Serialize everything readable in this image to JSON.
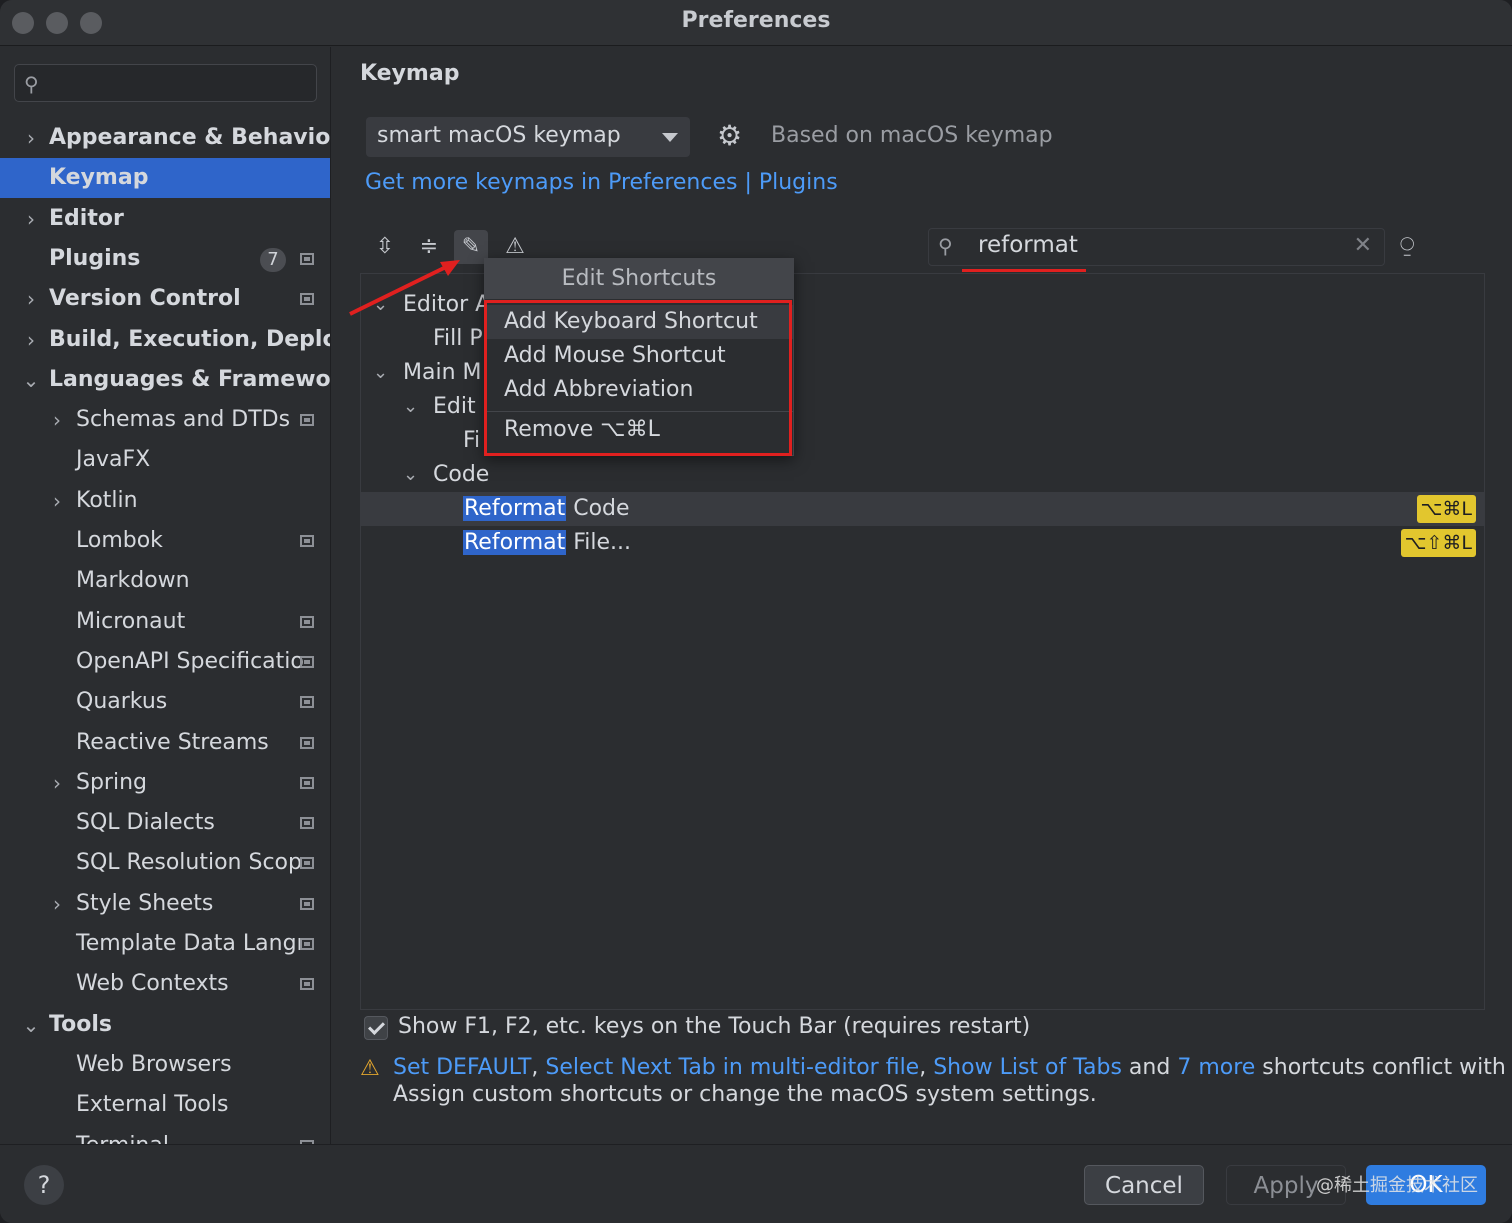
{
  "window": {
    "title": "Preferences"
  },
  "sidebar": {
    "search_placeholder": "",
    "items": [
      {
        "label": "Appearance & Behavior",
        "chevron": "›",
        "bold": true
      },
      {
        "label": "Keymap",
        "chevron": "",
        "bold": true,
        "selected": true
      },
      {
        "label": "Editor",
        "chevron": "›",
        "bold": true
      },
      {
        "label": "Plugins",
        "chevron": "",
        "bold": true,
        "badge": "7",
        "icon": "project-icon"
      },
      {
        "label": "Version Control",
        "chevron": "›",
        "bold": true,
        "icon": "project-icon"
      },
      {
        "label": "Build, Execution, Deploy",
        "chevron": "›",
        "bold": true
      },
      {
        "label": "Languages & Framewor",
        "chevron": "⌄",
        "bold": true
      },
      {
        "label": "Schemas and DTDs",
        "chevron": "›",
        "icon": "project-icon"
      },
      {
        "label": "JavaFX",
        "chevron": ""
      },
      {
        "label": "Kotlin",
        "chevron": "›"
      },
      {
        "label": "Lombok",
        "chevron": "",
        "icon": "project-icon"
      },
      {
        "label": "Markdown",
        "chevron": ""
      },
      {
        "label": "Micronaut",
        "chevron": "",
        "icon": "project-icon"
      },
      {
        "label": "OpenAPI Specificatio",
        "chevron": "",
        "icon": "project-icon"
      },
      {
        "label": "Quarkus",
        "chevron": "",
        "icon": "project-icon"
      },
      {
        "label": "Reactive Streams",
        "chevron": "",
        "icon": "project-icon"
      },
      {
        "label": "Spring",
        "chevron": "›",
        "icon": "project-icon"
      },
      {
        "label": "SQL Dialects",
        "chevron": "",
        "icon": "project-icon"
      },
      {
        "label": "SQL Resolution Scop",
        "chevron": "",
        "icon": "project-icon"
      },
      {
        "label": "Style Sheets",
        "chevron": "›",
        "icon": "project-icon"
      },
      {
        "label": "Template Data Langı",
        "chevron": "",
        "icon": "project-icon"
      },
      {
        "label": "Web Contexts",
        "chevron": "",
        "icon": "project-icon"
      },
      {
        "label": "Tools",
        "chevron": "⌄",
        "bold": true
      },
      {
        "label": "Web Browsers",
        "chevron": ""
      },
      {
        "label": "External Tools",
        "chevron": ""
      },
      {
        "label": "Terminal",
        "chevron": "",
        "icon": "project-icon"
      }
    ]
  },
  "main": {
    "heading": "Keymap",
    "keymap_select": "smart macOS keymap",
    "based_on": "Based on macOS keymap",
    "get_more_link": "Get more keymaps in Preferences | Plugins",
    "toolbar": {
      "expand_all_icon": "expand-all-icon",
      "collapse_all_icon": "collapse-all-icon",
      "edit_icon": "pencil-icon",
      "conflicts_icon": "warning-icon"
    },
    "filter_value": "reformat",
    "tree": {
      "editor_actions": "Editor A",
      "fill_p": "Fill P",
      "main_menu": "Main M",
      "edit": "Edit",
      "fi": "Fi",
      "code": "Code",
      "reformat_code": {
        "match": "Reformat",
        "rest": " Code",
        "shortcut": "⌥⌘L"
      },
      "reformat_file": {
        "match": "Reformat",
        "rest": " File...",
        "shortcut": "⌥⇧⌘L"
      }
    },
    "popup": {
      "title": "Edit Shortcuts",
      "items": [
        "Add Keyboard Shortcut",
        "Add Mouse Shortcut",
        "Add Abbreviation"
      ],
      "remove": "Remove ⌥⌘L"
    },
    "touchbar_option": "Show F1, F2, etc. keys on the Touch Bar (requires restart)",
    "touchbar_checked": true,
    "warning": {
      "link1": "Set DEFAULT",
      "sep1": ", ",
      "link2": "Select Next Tab in multi-editor file",
      "sep2": ", ",
      "link3": "Show List of Tabs",
      "and": " and ",
      "link4": "7 more",
      "tail": " shortcuts conflict with",
      "line2": "Assign custom shortcuts or change the macOS system settings."
    }
  },
  "footer": {
    "help": "?",
    "cancel": "Cancel",
    "apply": "Apply",
    "ok": "OK",
    "watermark": "@稀土掘金技术社区"
  },
  "colors": {
    "accent": "#2f65ca",
    "link": "#4d9bf8",
    "highlight_box": "#e0201f",
    "shortcut_badge": "#e2c62e"
  }
}
